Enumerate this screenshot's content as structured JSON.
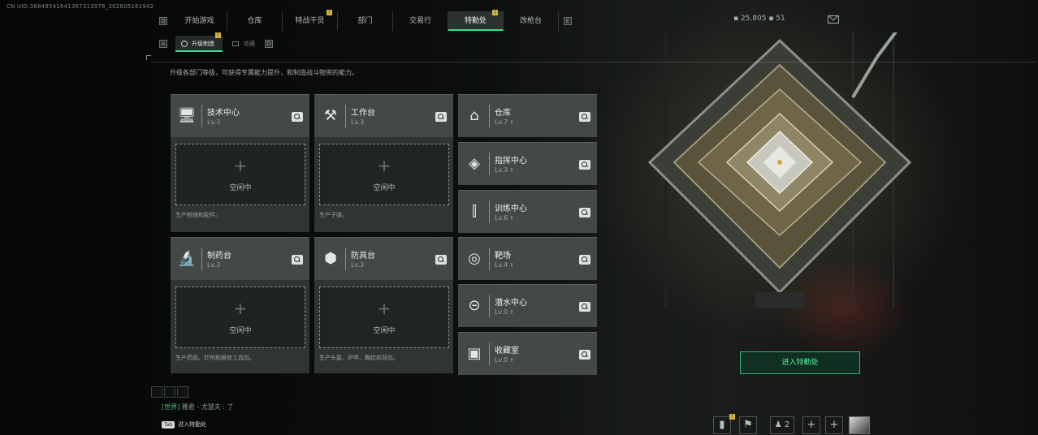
{
  "uid": "CN UID:3684954164138731397​6_20260516194​2",
  "top_tabs": [
    {
      "label": "开始游戏",
      "badge": ""
    },
    {
      "label": "仓库",
      "badge": ""
    },
    {
      "label": "特战干员",
      "badge": "!"
    },
    {
      "label": "部门",
      "badge": ""
    },
    {
      "label": "交易行",
      "badge": ""
    },
    {
      "label": "特勤处",
      "badge": "!",
      "active": true
    },
    {
      "label": "改枪台",
      "badge": ""
    }
  ],
  "nav_keys": {
    "prev": "Q",
    "next": "E",
    "sub_prev": "A",
    "sub_next": "D"
  },
  "sub_tabs": {
    "active": "升级制造",
    "active_badge": "!",
    "inactive": "收藏"
  },
  "description": "升级各部门等级，可获得专属能力提升，和制造战斗物资的能力。",
  "currency": "▪ 25,805   ▪ 51",
  "facilities_large": [
    {
      "name": "技术中心",
      "level": "Lv.3",
      "icon": "computer-icon",
      "glyph": "🖥",
      "slot": "空闲中",
      "note": "生产枪械和配件。"
    },
    {
      "name": "工作台",
      "level": "Lv.3",
      "icon": "tools-icon",
      "glyph": "⚒",
      "slot": "空闲中",
      "note": "生产子弹。"
    },
    {
      "name": "制药台",
      "level": "Lv.3",
      "icon": "microscope-icon",
      "glyph": "🔬",
      "slot": "空闲中",
      "note": "生产药品、针剂和维修工具包。"
    },
    {
      "name": "防具台",
      "level": "Lv.3",
      "icon": "armor-icon",
      "glyph": "⬢",
      "slot": "空闲中",
      "note": "生产头盔、护甲、胸挂和背包。"
    }
  ],
  "facilities_small": [
    {
      "name": "仓库",
      "level": "Lv.7",
      "icon": "warehouse-icon",
      "glyph": "⌂"
    },
    {
      "name": "指挥中心",
      "level": "Lv.3",
      "icon": "command-icon",
      "glyph": "◈"
    },
    {
      "name": "训练中心",
      "level": "Lv.6",
      "icon": "dumbbell-icon",
      "glyph": "⫿"
    },
    {
      "name": "靶场",
      "level": "Lv.4",
      "icon": "target-icon",
      "glyph": "◎"
    },
    {
      "name": "潜水中心",
      "level": "Lv.0",
      "icon": "goggles-icon",
      "glyph": "⊝"
    },
    {
      "name": "收藏室",
      "level": "Lv.0",
      "icon": "display-case-icon",
      "glyph": "▣"
    }
  ],
  "enter_button": "进入特勤处",
  "chat": {
    "tag": "[世界]",
    "text": "雅君 - 尤慧夫 : 了"
  },
  "tab_hint": {
    "key": "Tab",
    "label": "进入特勤处"
  },
  "bottom_right": {
    "stats_badge": "!",
    "friends_count": "2"
  }
}
